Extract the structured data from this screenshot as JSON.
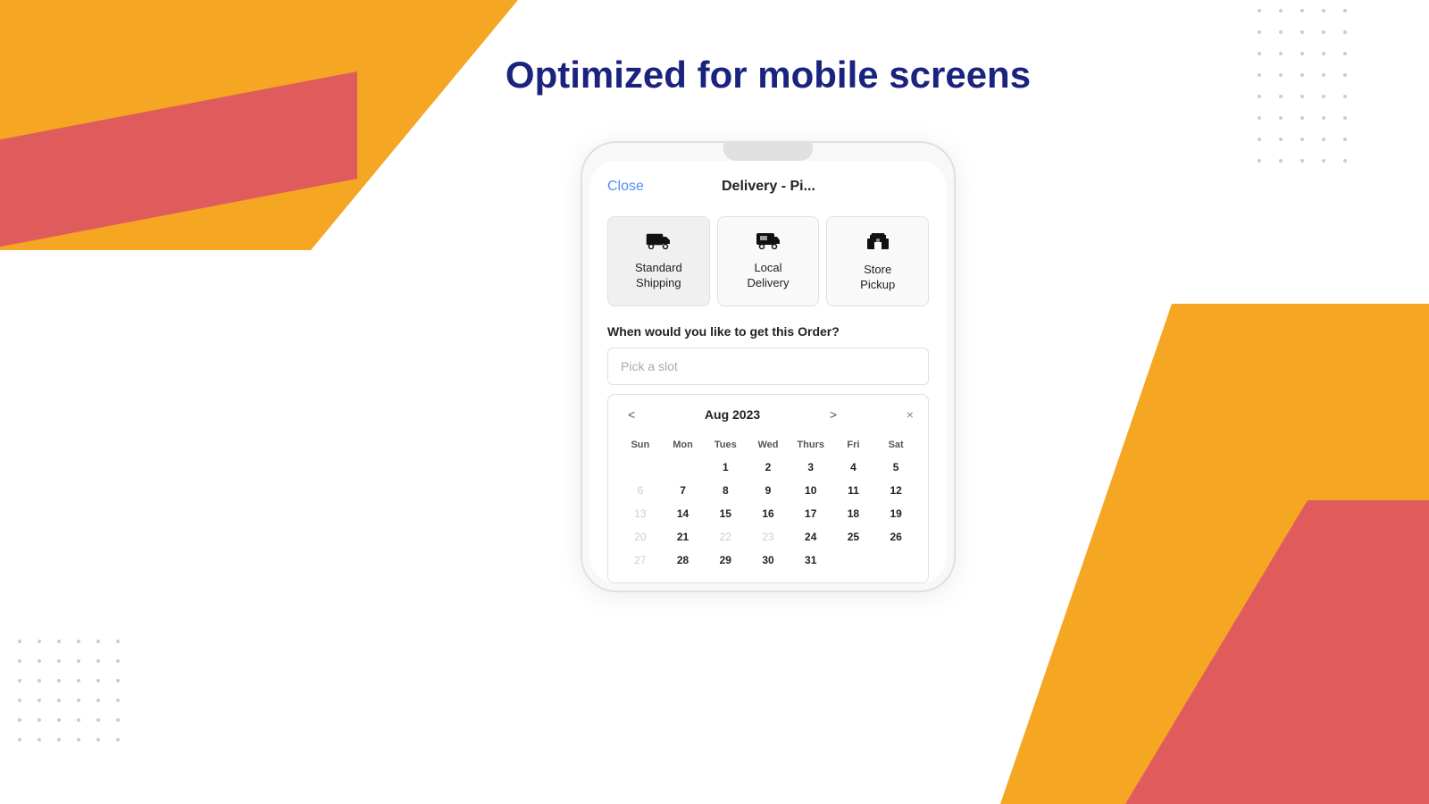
{
  "page": {
    "title": "Optimized for mobile screens"
  },
  "header": {
    "close_label": "Close",
    "title": "Delivery - Pi..."
  },
  "delivery_options": [
    {
      "id": "standard-shipping",
      "label": "Standard Shipping",
      "icon": "🚚",
      "selected": true
    },
    {
      "id": "local-delivery",
      "label": "Local Delivery",
      "icon": "🚐",
      "selected": false
    },
    {
      "id": "store-pickup",
      "label": "Store Pickup",
      "icon": "🏪",
      "selected": false
    }
  ],
  "calendar": {
    "question": "When would you like to get this Order?",
    "slot_placeholder": "Pick a slot",
    "month_label": "Aug 2023",
    "prev_nav": "<",
    "next_nav": ">",
    "close": "×",
    "day_headers": [
      "Sun",
      "Mon",
      "Tues",
      "Wed",
      "Thurs",
      "Fri",
      "Sat"
    ],
    "weeks": [
      [
        "",
        "",
        "1",
        "2",
        "3",
        "4",
        "5"
      ],
      [
        "6",
        "7",
        "8",
        "9",
        "10",
        "11",
        "12"
      ],
      [
        "13",
        "14",
        "15",
        "16",
        "17",
        "18",
        "19"
      ],
      [
        "20",
        "21",
        "22",
        "23",
        "24",
        "25",
        "26"
      ],
      [
        "27",
        "28",
        "29",
        "30",
        "31",
        "",
        ""
      ]
    ],
    "disabled_days": [
      "6",
      "13",
      "20",
      "22",
      "23",
      "27"
    ],
    "active_days": [
      "7",
      "8",
      "9",
      "10",
      "11",
      "12",
      "14",
      "15",
      "16",
      "17",
      "18",
      "19",
      "21",
      "24",
      "25",
      "26",
      "28",
      "29",
      "30",
      "31"
    ]
  }
}
